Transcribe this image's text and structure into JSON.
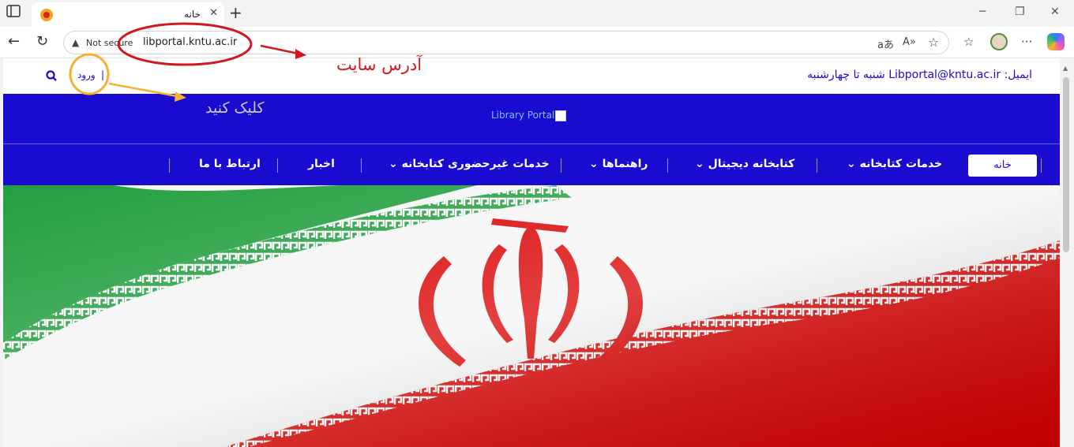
{
  "browser": {
    "tab_title": "خانه",
    "close_glyph": "✕",
    "new_tab_glyph": "+",
    "not_secure": "Not secure",
    "url": "libportal.kntu.ac.ir"
  },
  "site": {
    "email_line": "ایمیل: Libportal@kntu.ac.ir شنبه تا چهارشنبه",
    "login": "ورود",
    "logo_alt": "Library Portal",
    "nav": {
      "home": "خانه",
      "library_services": "خدمات کتابخانه",
      "digital_library": "کتابخانه دیجیتال",
      "guides": "راهنماها",
      "remote_services": "خدمات غیرحضوری کتابخانه",
      "news": "اخبار",
      "contact": "ارتباط با ما"
    },
    "dropdown_glyph": "⌄"
  },
  "annotations": {
    "site_address": "آدرس سایت",
    "click_here": "کلیک کنید"
  },
  "colors": {
    "brand_blue": "#1a0bd0",
    "annotation_red": "#d2181f",
    "annotation_orange": "#f4b230",
    "flag_green": "#239f40",
    "flag_red": "#da0000"
  }
}
